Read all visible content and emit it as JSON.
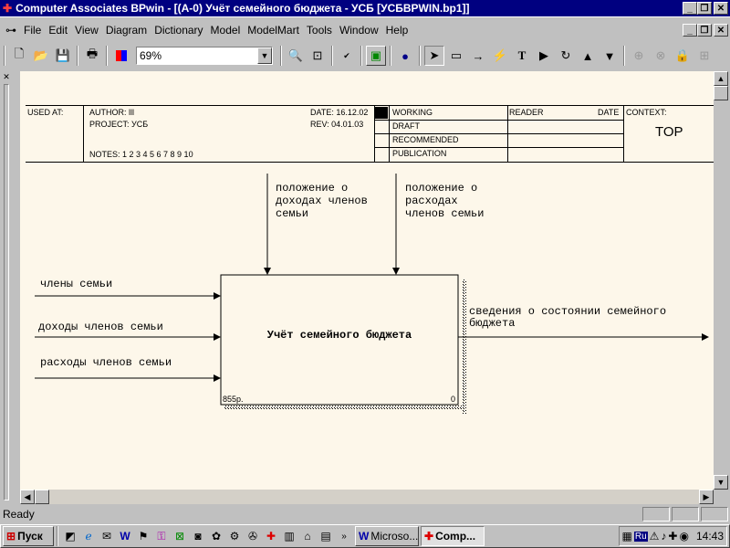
{
  "window": {
    "title": "Computer Associates BPwin - [(A-0) Учёт семейного бюджета - УСБ  [УСБBPWIN.bp1]]"
  },
  "menu": [
    "File",
    "Edit",
    "View",
    "Diagram",
    "Dictionary",
    "Model",
    "ModelMart",
    "Tools",
    "Window",
    "Help"
  ],
  "toolbar": {
    "zoom": "69%"
  },
  "header": {
    "used_at": "USED AT:",
    "author": "AUTHOR:  lll",
    "project": "PROJECT:  УСБ",
    "date": "DATE:  16.12.02",
    "rev": "REV:   04.01.03",
    "notes": "NOTES:  1  2  3  4  5  6  7  8  9  10",
    "statuses": [
      "WORKING",
      "DRAFT",
      "RECOMMENDED",
      "PUBLICATION"
    ],
    "reader": "READER",
    "date2": "DATE",
    "context": "CONTEXT:",
    "context_value": "TOP"
  },
  "diagram": {
    "box_title": "Учёт семейного бюджета",
    "box_cost": "855р.",
    "box_number": "0",
    "controls": [
      [
        "положение о",
        "доходах членов",
        "семьи"
      ],
      [
        "положение о",
        "расходах",
        "членов семьи"
      ]
    ],
    "inputs": [
      "члены семьи",
      "доходы членов семьи",
      "расходы членов семьи"
    ],
    "output": [
      "сведения о состоянии семейного",
      "бюджета"
    ]
  },
  "status": {
    "text": "Ready"
  },
  "taskbar": {
    "start": "Пуск",
    "tasks": [
      "Microso...",
      "Comp..."
    ],
    "lang": "Ru",
    "time": "14:43"
  },
  "colors": {
    "title_bg": "#000080",
    "canvas_bg": "#fdf7ea",
    "chrome": "#c0c0c0"
  }
}
